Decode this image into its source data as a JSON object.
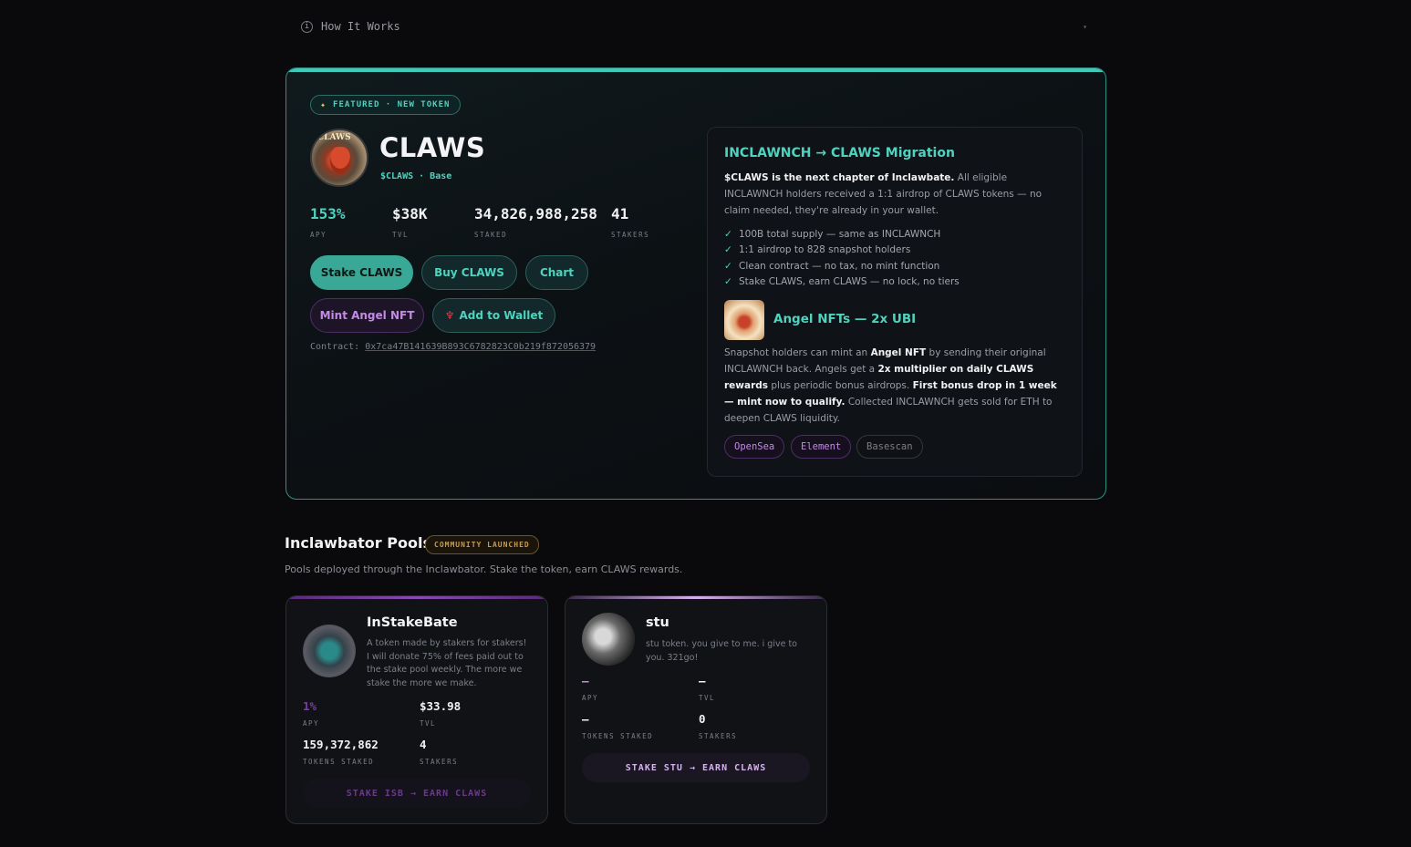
{
  "how": {
    "label": "How It Works"
  },
  "featured": {
    "badge": "FEATURED · NEW TOKEN",
    "logo_text": "CLAWS",
    "name": "CLAWS",
    "ticker": "$CLAWS · Base",
    "stats": [
      {
        "value": "153%",
        "label": "APY"
      },
      {
        "value": "$38K",
        "label": "TVL"
      },
      {
        "value": "34,826,988,258",
        "label": "STAKED"
      },
      {
        "value": "41",
        "label": "STAKERS"
      }
    ],
    "buttons": {
      "stake": "Stake CLAWS",
      "buy": "Buy CLAWS",
      "chart": "Chart",
      "mint": "Mint Angel NFT",
      "wallet": "Add to Wallet"
    },
    "contract_label": "Contract:",
    "contract_address": "0x7ca47B141639B893C6782823C0b219f872056379",
    "migration": {
      "title": "INCLAWNCH → CLAWS Migration",
      "intro_bold": "$CLAWS is the next chapter of Inclawbate.",
      "intro_rest": " All eligible INCLAWNCH holders received a 1:1 airdrop of CLAWS tokens — no claim needed, they're already in your wallet.",
      "bullets": [
        "100B total supply — same as INCLAWNCH",
        "1:1 airdrop to 828 snapshot holders",
        "Clean contract — no tax, no mint function",
        "Stake CLAWS, earn CLAWS — no lock, no tiers"
      ],
      "angel_title": "Angel NFTs — 2x UBI",
      "angel_t1": "Snapshot holders can mint an ",
      "angel_b1": "Angel NFT",
      "angel_t2": " by sending their original INCLAWNCH back. Angels get a ",
      "angel_b2": "2x multiplier on daily CLAWS rewards",
      "angel_t3": " plus periodic bonus airdrops. ",
      "angel_b3": "First bonus drop in 1 week — mint now to qualify.",
      "angel_t4": " Collected INCLAWNCH gets sold for ETH to deepen CLAWS liquidity.",
      "links": [
        "OpenSea",
        "Element",
        "Basescan"
      ]
    }
  },
  "pools": {
    "title": "Inclawbator Pools",
    "badge": "COMMUNITY LAUNCHED",
    "subtitle": "Pools deployed through the Inclawbator. Stake the token, earn CLAWS rewards.",
    "cards": [
      {
        "name": "InStakeBate",
        "desc": "A token made by stakers for stakers! I will donate 75% of fees paid out to the stake pool weekly. The more we stake the more we make.",
        "apy": "1%",
        "apy_label": "APY",
        "tvl": "$33.98",
        "tvl_label": "TVL",
        "staked": "159,372,862",
        "staked_label": "TOKENS STAKED",
        "stakers": "4",
        "stakers_label": "STAKERS",
        "cta": "STAKE ISB → EARN CLAWS"
      },
      {
        "name": "stu",
        "desc": "stu token. you give to me. i give to you. 321go!",
        "apy": "—",
        "apy_label": "APY",
        "tvl": "—",
        "tvl_label": "TVL",
        "staked": "—",
        "staked_label": "TOKENS STAKED",
        "stakers": "0",
        "stakers_label": "STAKERS",
        "cta": "STAKE STU → EARN CLAWS"
      }
    ]
  },
  "colors": {
    "accent": "#4fd3bf",
    "purple": "#c48ae6",
    "background": "#0a0a0c"
  }
}
